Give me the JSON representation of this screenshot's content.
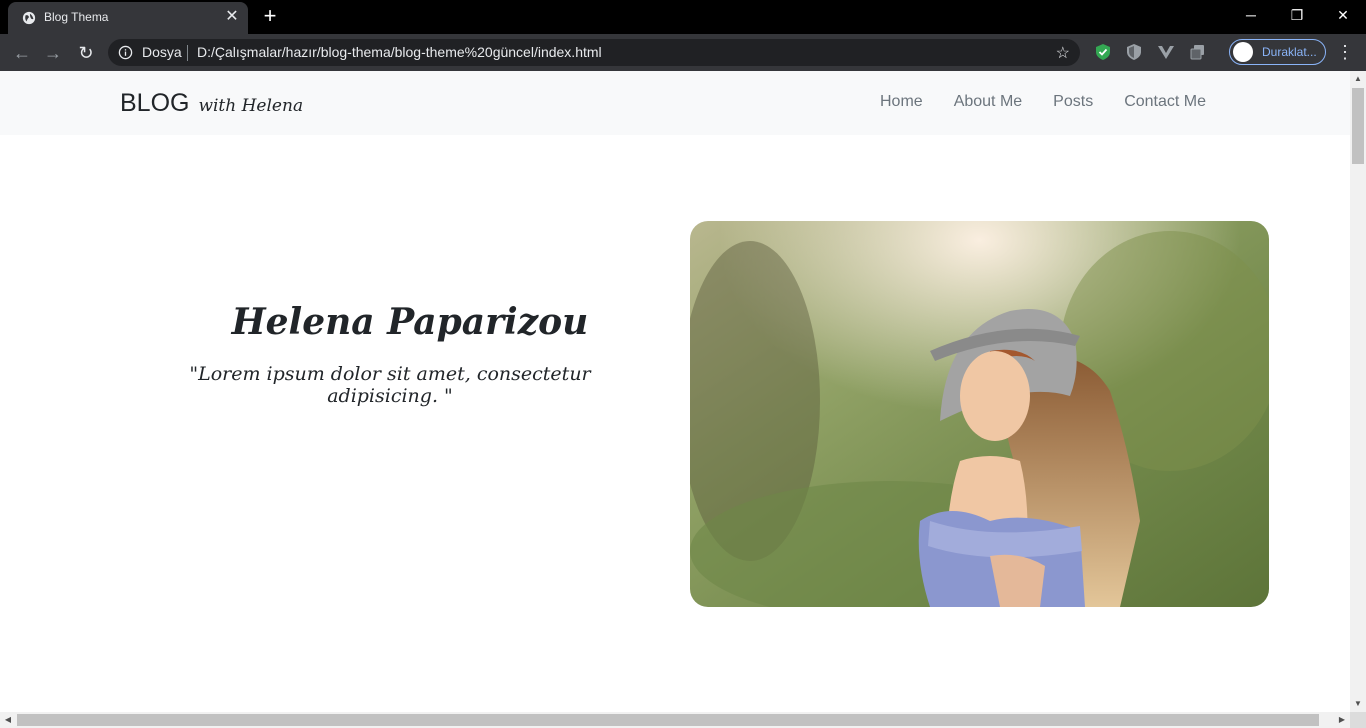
{
  "browser": {
    "tab_title": "Blog Thema",
    "close_tab_glyph": "✕",
    "new_tab_glyph": "+",
    "window_controls": {
      "minimize": "─",
      "restore": "❐",
      "close": "✕"
    },
    "back_glyph": "←",
    "forward_glyph": "→",
    "reload_glyph": "↻",
    "address_scheme": "Dosya",
    "address_url": "D:/Çalışmalar/hazır/blog-thema/blog-theme%20güncel/index.html",
    "star_glyph": "☆",
    "profile_label": "Duraklat...",
    "menu_glyph": "⋮",
    "accent_color": "#8ab4f8"
  },
  "site": {
    "brand_main": "BLOG",
    "brand_script": "with Helena",
    "nav": {
      "home": "Home",
      "about": "About Me",
      "posts": "Posts",
      "contact": "Contact Me"
    },
    "hero": {
      "name": "Helena Paparizou",
      "quote": "\"Lorem ipsum dolor sit amet, consectetur adipisicing. \""
    }
  },
  "scrollbars": {
    "up": "▲",
    "down": "▼",
    "left": "◀",
    "right": "▶"
  }
}
